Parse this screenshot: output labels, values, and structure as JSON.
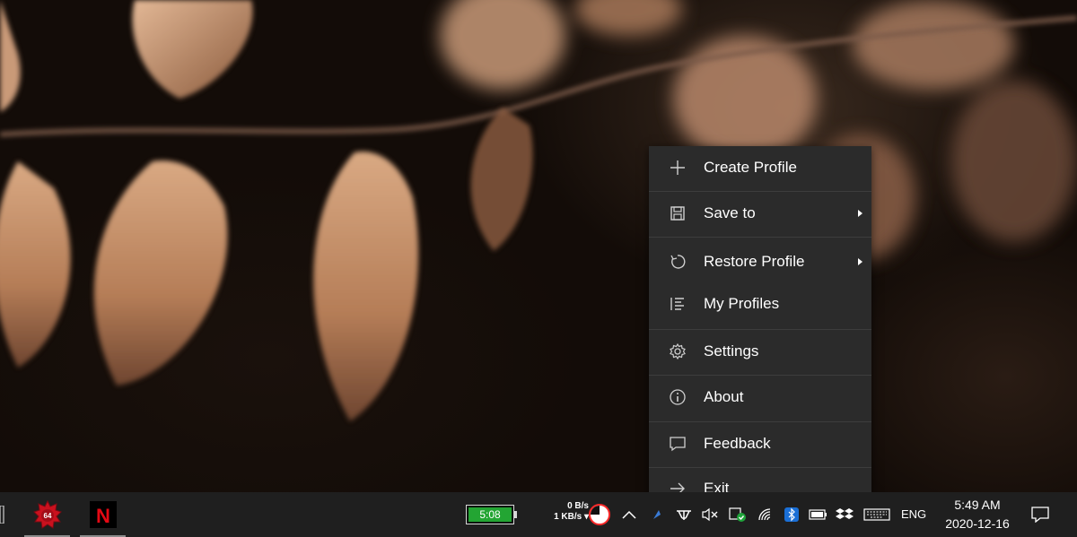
{
  "context_menu": {
    "items": [
      {
        "label": "Create Profile",
        "icon": "plus-icon",
        "has_submenu": false
      },
      {
        "label": "Save to",
        "icon": "floppy-disk-icon",
        "has_submenu": true
      },
      {
        "label": "Restore Profile",
        "icon": "restore-icon",
        "has_submenu": true
      },
      {
        "label": "My Profiles",
        "icon": "list-icon",
        "has_submenu": false
      },
      {
        "label": "Settings",
        "icon": "gear-icon",
        "has_submenu": false
      },
      {
        "label": "About",
        "icon": "info-icon",
        "has_submenu": false
      },
      {
        "label": "Feedback",
        "icon": "speech-bubble-icon",
        "has_submenu": false
      },
      {
        "label": "Exit",
        "icon": "arrow-right-icon",
        "has_submenu": false
      }
    ],
    "background": "#2b2b2b",
    "text_color": "#ffffff"
  },
  "taskbar": {
    "apps": [
      {
        "name": "system-monitor-app",
        "badge": "64",
        "icon": "red-gear-icon"
      },
      {
        "name": "netflix-app",
        "letter": "N",
        "icon": "netflix-icon"
      }
    ],
    "tray": {
      "battery_time": "5:08",
      "battery_color": "#23a533",
      "net_upload": "0 B/s",
      "net_download": "1 KB/s",
      "language": "ENG",
      "time": "5:49 AM",
      "date": "2020-12-16"
    },
    "background": "#1f1f1f"
  }
}
